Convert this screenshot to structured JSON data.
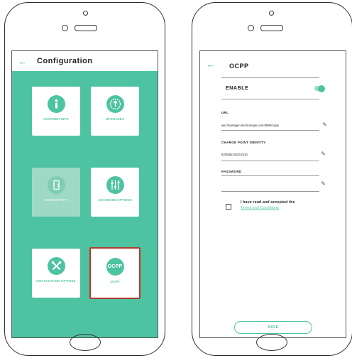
{
  "left_screen": {
    "title": "Configuration",
    "back_icon": "←",
    "tiles": [
      {
        "label": "CHARGER INFO",
        "icon": "info-icon"
      },
      {
        "label": "UPGRADES",
        "icon": "upgrade-icon"
      },
      {
        "label": "CONNECTIVITY",
        "icon": "connectivity-icon"
      },
      {
        "label": "ADVANCED OPTIONS",
        "icon": "sliders-icon"
      },
      {
        "label": "INSTALLATION OPTIONS",
        "icon": "tools-icon"
      },
      {
        "label": "OCPP",
        "icon_text": "OCPP"
      }
    ]
  },
  "right_screen": {
    "title": "OCPP",
    "back_icon": "←",
    "enable_label": "ENABLE",
    "enable_on": true,
    "url_label": "URL",
    "url_value": "ws://manager.electromaps.com:8080/ocpp",
    "cpid_label": "CHARGE POINT IDENTITY",
    "cpid_value": "6335ddc40221fe1b",
    "password_label": "PASSWORD",
    "password_value": "",
    "terms_text": "I have read and accepted the",
    "terms_link": "Terms and Conditions",
    "save_label": "SAVE"
  },
  "colors": {
    "accent": "#4ec3a1",
    "highlight": "#b23a2e"
  }
}
